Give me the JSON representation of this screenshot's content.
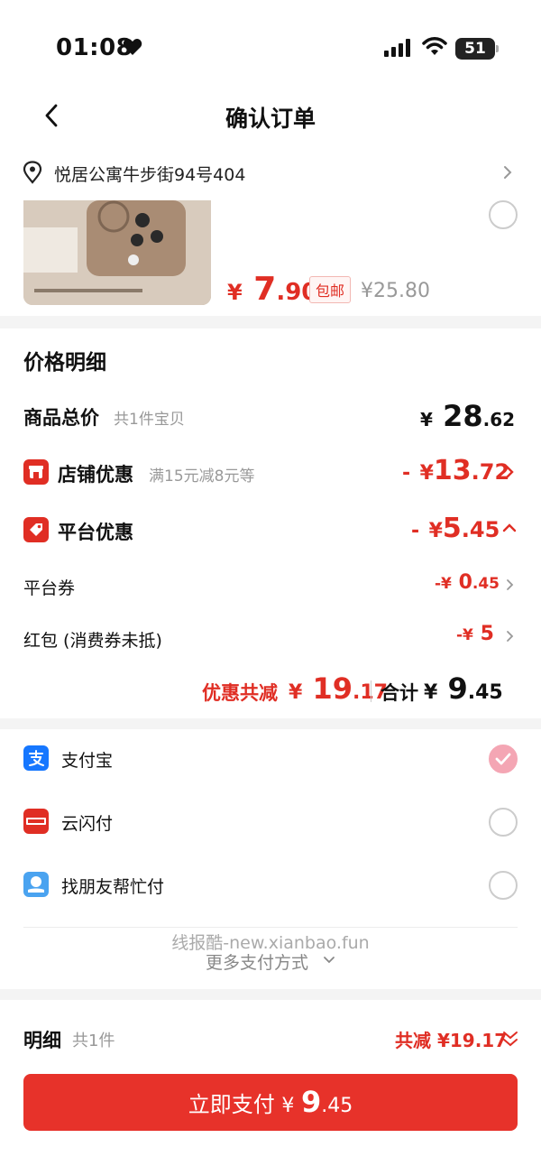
{
  "status": {
    "time": "01:08",
    "battery": "51"
  },
  "nav": {
    "title": "确认订单"
  },
  "address": "悦居公寓牛步街94号404",
  "product": {
    "currency": "¥",
    "price_int": "7",
    "price_dec": ".90",
    "shipping_tag": "包邮",
    "original_price": "¥25.80"
  },
  "price_detail": {
    "title": "价格明细",
    "goods_total": {
      "label": "商品总价",
      "sub": "共1件宝贝",
      "currency": "¥",
      "int": "28",
      "dec": ".62"
    },
    "shop_discount": {
      "label": "店铺优惠",
      "sub": "满15元减8元等",
      "dash": "-",
      "currency": "¥",
      "int": "13",
      "dec": ".72"
    },
    "platform_discount": {
      "label": "平台优惠",
      "dash": "-",
      "currency": "¥",
      "int": "5",
      "dec": ".45"
    },
    "platform_coupon": {
      "label": "平台券",
      "prefix": "-¥",
      "int": "0",
      "dec": ".45"
    },
    "red_packet": {
      "label": "红包 (消费券未抵)",
      "prefix": "-¥",
      "int": "5"
    },
    "saved": {
      "label": "优惠共减",
      "currency": "¥",
      "int": "19",
      "dec": ".17"
    },
    "total": {
      "label": "合计",
      "currency": "¥",
      "int": "9",
      "dec": ".45"
    }
  },
  "payment": {
    "methods": [
      {
        "label": "支付宝",
        "selected": true
      },
      {
        "label": "云闪付",
        "selected": false
      },
      {
        "label": "找朋友帮忙付",
        "selected": false
      }
    ],
    "more": "更多支付方式",
    "watermark": "线报酷-new.xianbao.fun"
  },
  "bottom": {
    "label": "明细",
    "sub": "共1件",
    "saved": "共减 ¥19.17",
    "button": {
      "label": "立即支付",
      "currency": "¥",
      "int": "9",
      "dec": ".45"
    }
  },
  "colors": {
    "accent": "#e02e24",
    "alipay": "#1677ff",
    "selected_radio": "#f4a6b4"
  }
}
